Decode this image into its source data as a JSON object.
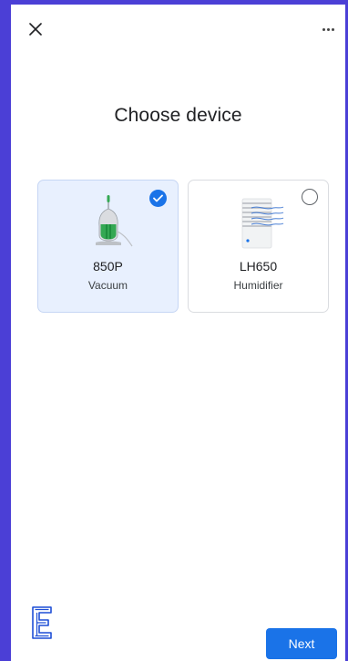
{
  "header": {
    "close_icon": "close-icon",
    "more_icon": "more-horiz-icon"
  },
  "page": {
    "title": "Choose device"
  },
  "devices": [
    {
      "model": "850P",
      "kind": "Vacuum",
      "icon": "vacuum-icon",
      "selected": true
    },
    {
      "model": "LH650",
      "kind": "Humidifier",
      "icon": "humidifier-icon",
      "selected": false
    }
  ],
  "footer": {
    "logo_icon": "brand-e-logo-icon",
    "next_label": "Next"
  },
  "colors": {
    "accent": "#1a73e8",
    "selected_card_bg": "#e8f0fe",
    "frame": "#4b3fd6"
  }
}
